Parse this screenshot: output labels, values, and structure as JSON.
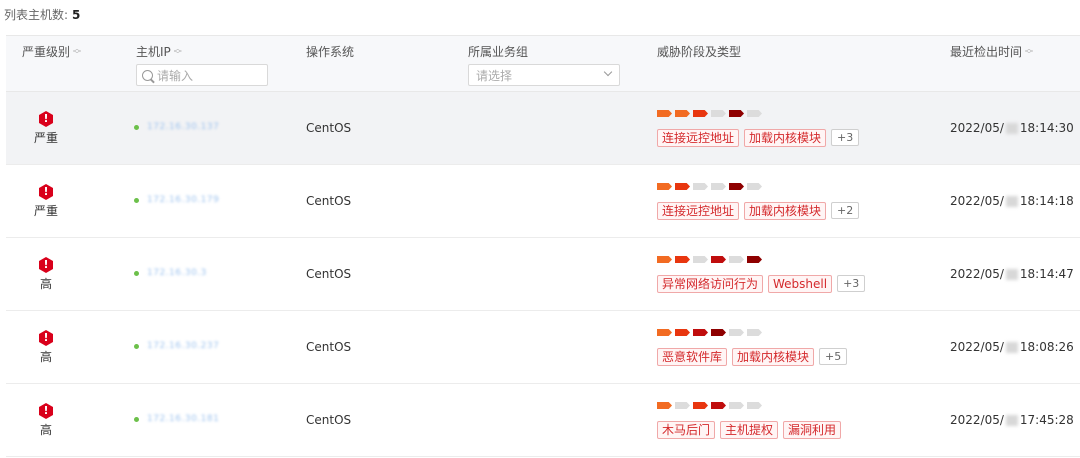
{
  "header": {
    "count_label": "列表主机数:",
    "count_value": "5"
  },
  "columns": {
    "severity": "严重级别",
    "host_ip": "主机IP",
    "os": "操作系统",
    "group": "所属业务组",
    "threat": "威胁阶段及类型",
    "time": "最近检出时间"
  },
  "filters": {
    "ip_placeholder": "请输入",
    "group_placeholder": "请选择"
  },
  "colors": {
    "severity_red": "#d9001b",
    "online_dot": "#6cc04a",
    "tag_text": "#d4292c",
    "tag_border": "#f0a8a8"
  },
  "rows": [
    {
      "severity": "严重",
      "ip": "172.16.30.137",
      "os": "CentOS",
      "stages": [
        1,
        1,
        2,
        0,
        4,
        0
      ],
      "tags": [
        "连接远控地址",
        "加载内核模块"
      ],
      "more": "+3",
      "time_prefix": "2022/05/",
      "time_suffix": "18:14:30"
    },
    {
      "severity": "严重",
      "ip": "172.16.30.179",
      "os": "CentOS",
      "stages": [
        1,
        2,
        0,
        0,
        4,
        0
      ],
      "tags": [
        "连接远控地址",
        "加载内核模块"
      ],
      "more": "+2",
      "time_prefix": "2022/05/",
      "time_suffix": "18:14:18"
    },
    {
      "severity": "高",
      "ip": "172.16.30.3",
      "os": "CentOS",
      "stages": [
        1,
        2,
        0,
        3,
        0,
        4
      ],
      "tags": [
        "异常网络访问行为",
        "Webshell"
      ],
      "more": "+3",
      "time_prefix": "2022/05/",
      "time_suffix": "18:14:47"
    },
    {
      "severity": "高",
      "ip": "172.16.30.237",
      "os": "CentOS",
      "stages": [
        1,
        2,
        3,
        4,
        0,
        0
      ],
      "tags": [
        "恶意软件库",
        "加载内核模块"
      ],
      "more": "+5",
      "time_prefix": "2022/05/",
      "time_suffix": "18:08:26"
    },
    {
      "severity": "高",
      "ip": "172.16.30.181",
      "os": "CentOS",
      "stages": [
        1,
        0,
        2,
        3,
        0,
        0
      ],
      "tags": [
        "木马后门",
        "主机提权",
        "漏洞利用"
      ],
      "more": "",
      "time_prefix": "2022/05/",
      "time_suffix": "17:45:28"
    }
  ]
}
